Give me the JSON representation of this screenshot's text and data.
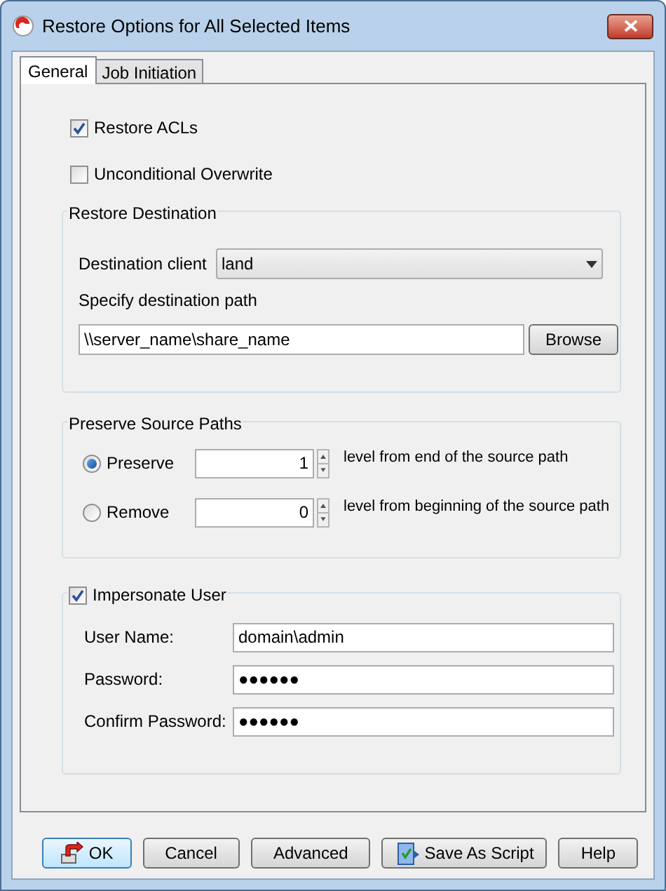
{
  "window": {
    "title": "Restore Options for All Selected Items"
  },
  "tabs": [
    {
      "label": "General",
      "selected": true
    },
    {
      "label": "Job Initiation",
      "selected": false
    }
  ],
  "options": [
    {
      "label": "Restore ACLs",
      "checked": true
    },
    {
      "label": "Unconditional Overwrite",
      "checked": false
    }
  ],
  "restore_destination": {
    "title": "Restore Destination",
    "client_label": "Destination client",
    "client_value": "land",
    "path_label": "Specify destination path",
    "path_value": "\\\\server_name\\share_name",
    "browse": "Browse"
  },
  "preserve_source_paths": {
    "title": "Preserve Source Paths",
    "rows": [
      {
        "label": "Preserve",
        "selected": true,
        "value": "1",
        "note": "level from end of the source path"
      },
      {
        "label": "Remove",
        "selected": false,
        "value": "0",
        "note": "level from beginning of the source path"
      }
    ]
  },
  "impersonate": {
    "label": "Impersonate User",
    "checked": true,
    "fields": [
      {
        "label": "User Name:",
        "value": "domain\\admin"
      },
      {
        "label": "Password:",
        "value": "●●●●●●"
      },
      {
        "label": "Confirm Password:",
        "value": "●●●●●●"
      }
    ]
  },
  "buttons": [
    {
      "label": "OK",
      "kind": "ok"
    },
    {
      "label": "Cancel",
      "kind": "plain"
    },
    {
      "label": "Advanced",
      "kind": "plain"
    },
    {
      "label": "Save As Script",
      "kind": "script"
    },
    {
      "label": "Help",
      "kind": "plain"
    }
  ]
}
